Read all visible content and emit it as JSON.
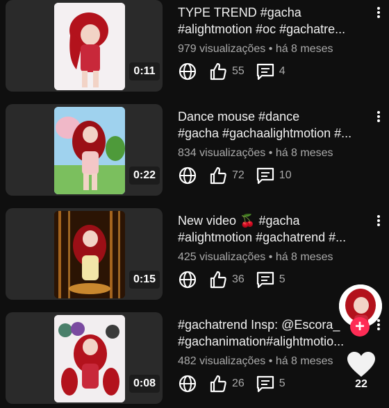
{
  "videos": [
    {
      "title_line1": "TYPE TREND #gacha",
      "title_line2": "#alightmotion #oc #gachatre...",
      "duration": "0:11",
      "views": "979 visualizações",
      "separator": "•",
      "age": "há 8 meses",
      "likes": "55",
      "comments": "4",
      "thumb_bg": "#f4f0f2"
    },
    {
      "title_line1": "Dance mouse #dance",
      "title_line2": "#gacha #gachaalightmotion #...",
      "duration": "0:22",
      "views": "834 visualizações",
      "separator": "•",
      "age": "há 8 meses",
      "likes": "72",
      "comments": "10",
      "thumb_bg": "#8fc7e8"
    },
    {
      "title_line1": "New video 🍒 #gacha",
      "title_line2": "#alightmotion #gachatrend #...",
      "duration": "0:15",
      "views": "425 visualizações",
      "separator": "•",
      "age": "há 8 meses",
      "likes": "36",
      "comments": "5",
      "thumb_bg": "#2b1404"
    },
    {
      "title_line1": "#gachatrend Insp: @Escora_",
      "title_line2": "#gachanimation#alightmotio...",
      "duration": "0:08",
      "views": "482 visualizações",
      "separator": "•",
      "age": "há 8 meses",
      "likes": "26",
      "comments": "5",
      "thumb_bg": "#f2eef0"
    }
  ],
  "overlay": {
    "plus": "+",
    "like_count": "22"
  },
  "colors": {
    "background": "#0f0f0f",
    "card": "#2a2a2a",
    "meta_text": "#aaaaaa",
    "follow_accent": "#fe2c55"
  }
}
